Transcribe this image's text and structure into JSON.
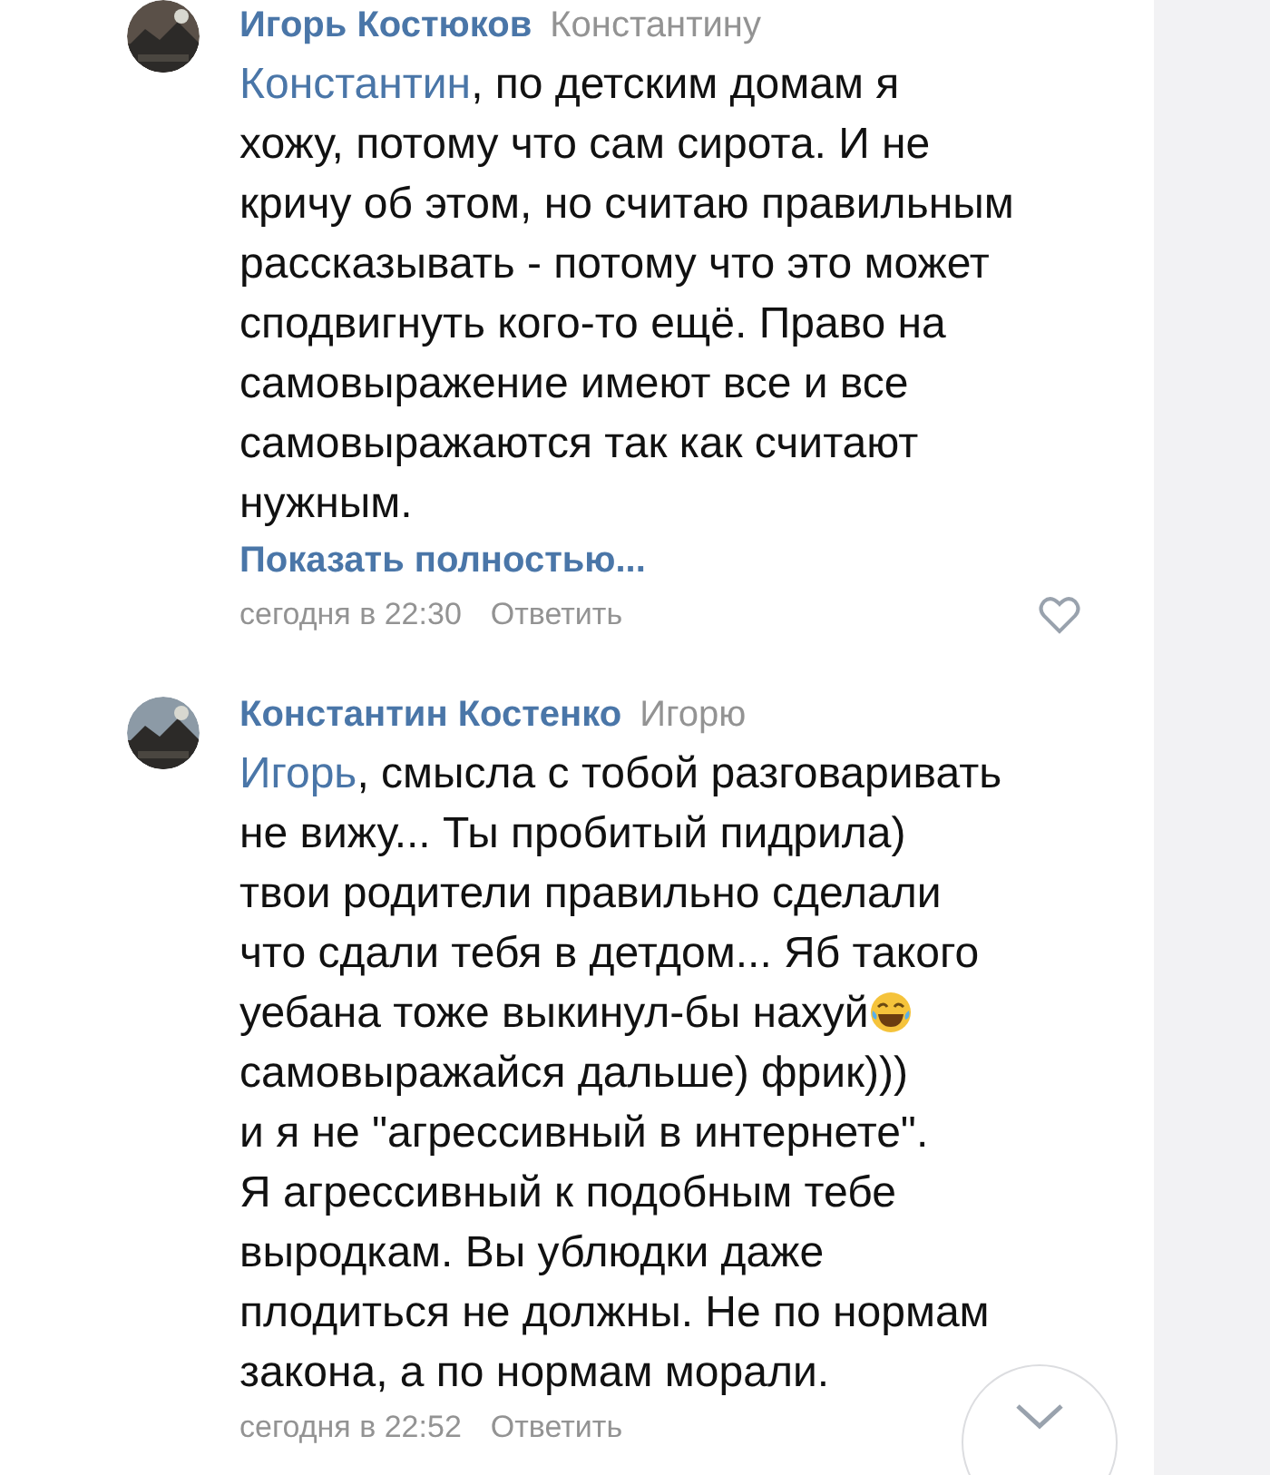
{
  "comments": [
    {
      "author": "Игорь Костюков",
      "reply_to": "Константину",
      "body": [
        {
          "kind": "mention",
          "text": "Константин"
        },
        {
          "kind": "text",
          "text": ", по детским домам я\nхожу, потому что сам сирота. И не\nкричу об этом, но считаю правильным\nрассказывать - потому что это может\nсподвигнуть кого-то ещё. Право на\nсамовыражение имеют все и все\nсамовыражаются так как считают\nнужным."
        }
      ],
      "show_more": "Показать полностью...",
      "time": "сегодня в 22:30",
      "reply": "Ответить",
      "liked": false
    },
    {
      "author": "Константин Костенко",
      "reply_to": "Игорю",
      "body": [
        {
          "kind": "mention",
          "text": "Игорь"
        },
        {
          "kind": "text",
          "text": ", смысла с тобой разговаривать\nне вижу... Ты пробитый пидрила)\nтвои родители правильно сделали\nчто сдали тебя в детдом... Яб такого\nуебана тоже выкинул-бы нахуй"
        },
        {
          "kind": "emoji"
        },
        {
          "kind": "text",
          "text": "\nсамовыражайся дальше) фрик)))\nи я не \"агрессивный в интернете\".\nЯ агрессивный к подобным тебе\nвыродкам. Вы ублюдки даже\nплодиться не должны. Не по нормам\nзакона, а по нормам морали."
        }
      ],
      "time": "сегодня в 22:52",
      "reply": "Ответить"
    }
  ]
}
